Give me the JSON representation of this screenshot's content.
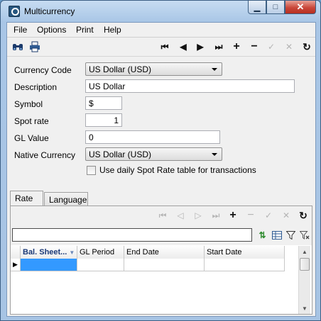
{
  "window": {
    "title": "Multicurrency",
    "caption": {
      "minimize": "▁",
      "maximize": "□",
      "close": "✕"
    }
  },
  "menu": [
    {
      "label": "File"
    },
    {
      "label": "Options"
    },
    {
      "label": "Print"
    },
    {
      "label": "Help"
    }
  ],
  "toolbar": {
    "left_icons": [
      "binoculars-icon",
      "printer-icon"
    ],
    "nav_icons": [
      {
        "name": "first-record-icon",
        "glyph": "⏮",
        "enabled": true
      },
      {
        "name": "previous-record-icon",
        "glyph": "◀",
        "enabled": true
      },
      {
        "name": "next-record-icon",
        "glyph": "▶",
        "enabled": true
      },
      {
        "name": "last-record-icon",
        "glyph": "⏭",
        "enabled": true
      },
      {
        "name": "add-record-icon",
        "glyph": "+",
        "enabled": true
      },
      {
        "name": "delete-record-icon",
        "glyph": "−",
        "enabled": true
      },
      {
        "name": "post-edit-icon",
        "glyph": "✓",
        "enabled": false
      },
      {
        "name": "cancel-edit-icon",
        "glyph": "✕",
        "enabled": false
      },
      {
        "name": "refresh-icon",
        "glyph": "↻",
        "enabled": true
      }
    ]
  },
  "form": {
    "currency_code": {
      "label": "Currency Code",
      "value": "US Dollar  (USD)"
    },
    "description": {
      "label": "Description",
      "value": "US Dollar"
    },
    "symbol": {
      "label": "Symbol",
      "value": "$"
    },
    "spot_rate": {
      "label": "Spot rate",
      "value": "1"
    },
    "gl_value": {
      "label": "GL Value",
      "value": "0"
    },
    "native_currency": {
      "label": "Native Currency",
      "value": "US Dollar  (USD)"
    },
    "daily_spot_rate": {
      "label": "Use daily Spot Rate table for transactions",
      "checked": false
    }
  },
  "tabs": [
    {
      "label": "Rate",
      "active": true
    },
    {
      "label": "Language",
      "active": false
    }
  ],
  "rate_grid": {
    "filter_value": "",
    "columns": [
      "Bal. Sheet...",
      "GL Period",
      "End Date",
      "Start Date"
    ],
    "rows": [
      [
        "",
        "",
        "",
        ""
      ]
    ]
  }
}
